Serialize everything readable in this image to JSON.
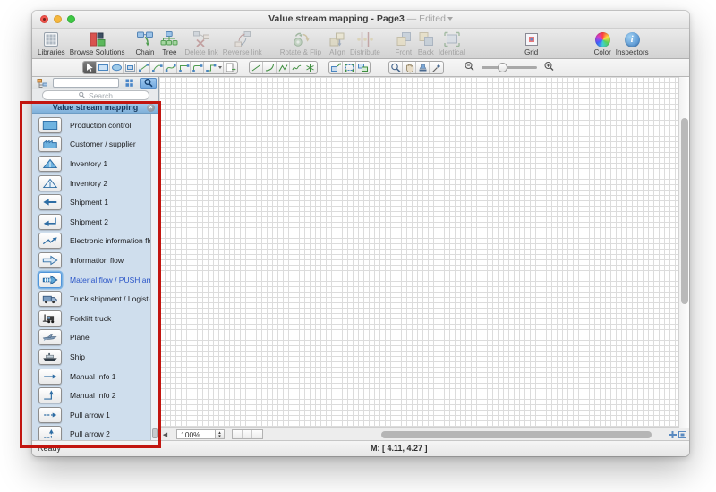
{
  "window": {
    "title": "Value stream mapping - Page3",
    "edited_suffix": "— Edited"
  },
  "toolbar": {
    "items": [
      {
        "label": "Libraries",
        "disabled": false
      },
      {
        "label": "Browse Solutions",
        "disabled": false
      },
      {
        "label": "Chain",
        "disabled": false
      },
      {
        "label": "Tree",
        "disabled": false
      },
      {
        "label": "Delete link",
        "disabled": true
      },
      {
        "label": "Reverse link",
        "disabled": true
      },
      {
        "label": "Rotate & Flip",
        "disabled": true
      },
      {
        "label": "Align",
        "disabled": true
      },
      {
        "label": "Distribute",
        "disabled": true
      },
      {
        "label": "Front",
        "disabled": true
      },
      {
        "label": "Back",
        "disabled": true
      },
      {
        "label": "Identical",
        "disabled": true
      },
      {
        "label": "Grid",
        "disabled": false
      },
      {
        "label": "Color",
        "disabled": false
      },
      {
        "label": "Inspectors",
        "disabled": false
      }
    ]
  },
  "sidebar": {
    "search_placeholder": "Search",
    "library_title": "Value stream mapping",
    "items": [
      {
        "label": "Production control"
      },
      {
        "label": "Customer / supplier"
      },
      {
        "label": "Inventory 1"
      },
      {
        "label": "Inventory 2"
      },
      {
        "label": "Shipment 1"
      },
      {
        "label": "Shipment 2"
      },
      {
        "label": "Electronic information flow"
      },
      {
        "label": "Information flow"
      },
      {
        "label": "Material flow / PUSH arrow",
        "selected": true
      },
      {
        "label": "Truck shipment / Logistics"
      },
      {
        "label": "Forklift truck"
      },
      {
        "label": "Plane"
      },
      {
        "label": "Ship"
      },
      {
        "label": "Manual Info 1"
      },
      {
        "label": "Manual Info 2"
      },
      {
        "label": "Pull arrow 1"
      },
      {
        "label": "Pull arrow 2"
      }
    ]
  },
  "canvas": {
    "zoom_level": "100%"
  },
  "statusbar": {
    "ready": "Ready",
    "mouse_position": "M: [ 4.11, 4.27 ]"
  },
  "annotation": {
    "highlight_color": "#c2150f"
  }
}
